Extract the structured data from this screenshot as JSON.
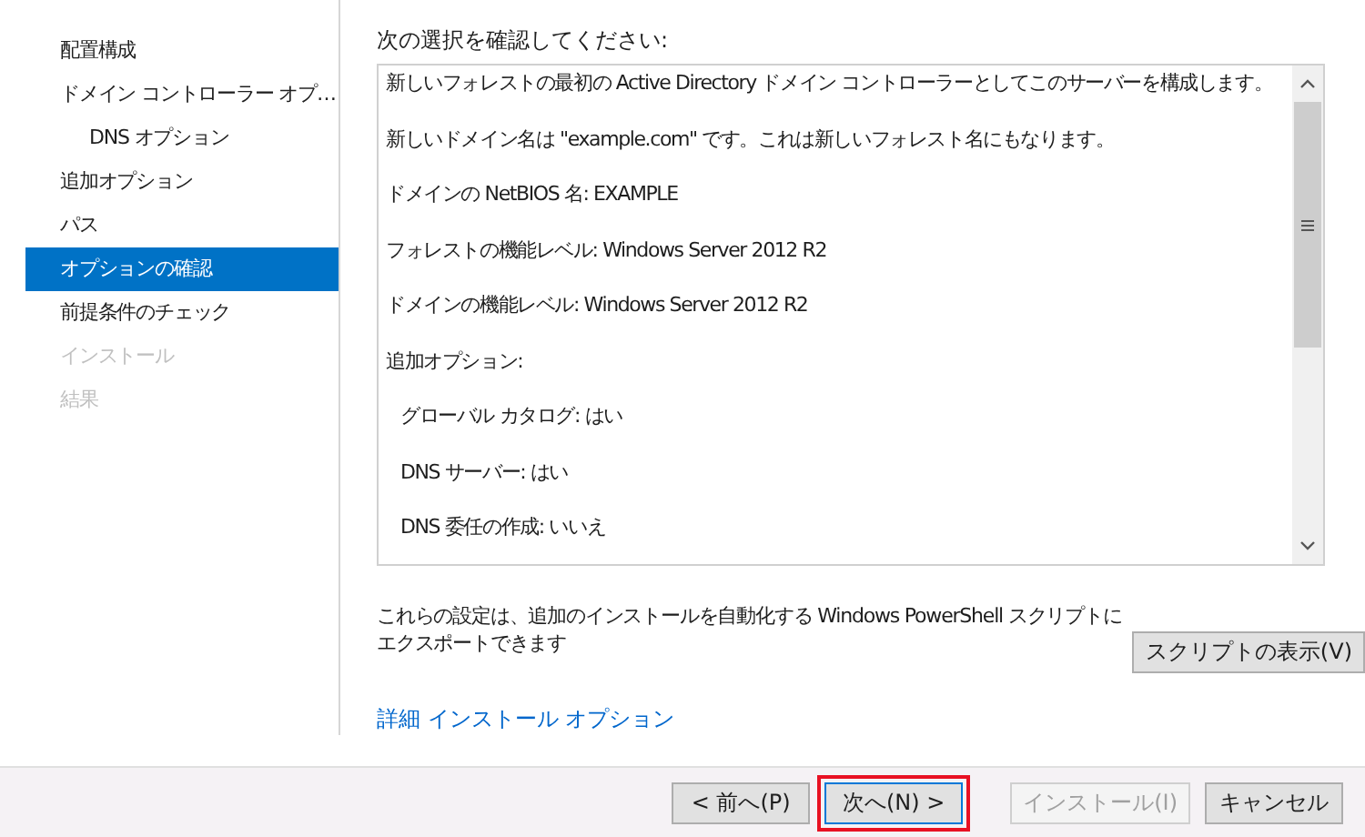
{
  "sidebar": {
    "items": [
      {
        "label": "配置構成",
        "selected": false,
        "disabled": false
      },
      {
        "label": "ドメイン コントローラー オプ…",
        "selected": false,
        "disabled": false,
        "children": [
          {
            "label": "DNS オプション",
            "selected": false,
            "disabled": false
          }
        ]
      },
      {
        "label": "追加オプション",
        "selected": false,
        "disabled": false
      },
      {
        "label": "パス",
        "selected": false,
        "disabled": false
      },
      {
        "label": "オプションの確認",
        "selected": true,
        "disabled": false
      },
      {
        "label": "前提条件のチェック",
        "selected": false,
        "disabled": false
      },
      {
        "label": "インストール",
        "selected": false,
        "disabled": true
      },
      {
        "label": "結果",
        "selected": false,
        "disabled": true
      }
    ]
  },
  "review": {
    "heading": "次の選択を確認してください:",
    "lines": [
      {
        "text": "新しいフォレストの最初の Active Directory ドメイン コントローラーとしてこのサーバーを構成します。",
        "indented": false
      },
      {
        "text": "新しいドメイン名は \"example.com\" です。これは新しいフォレスト名にもなります。",
        "indented": false
      },
      {
        "text": "ドメインの NetBIOS 名: EXAMPLE",
        "indented": false
      },
      {
        "text": "フォレストの機能レベル: Windows Server 2012 R2",
        "indented": false
      },
      {
        "text": "ドメインの機能レベル: Windows Server 2012 R2",
        "indented": false
      },
      {
        "text": "追加オプション:",
        "indented": false
      },
      {
        "text": "グローバル カタログ: はい",
        "indented": true
      },
      {
        "text": "DNS サーバー: はい",
        "indented": true
      },
      {
        "text": "DNS 委任の作成: いいえ",
        "indented": true
      }
    ]
  },
  "export_note": "これらの設定は、追加のインストールを自動化する Windows PowerShell スクリプトにエクスポートできます",
  "view_script_button": "スクリプトの表示(V)",
  "advanced_link": "詳細 インストール オプション",
  "buttons": [
    {
      "label": "< 前へ(P)",
      "disabled": false,
      "highlighted": false
    },
    {
      "label": "次へ(N) >",
      "disabled": false,
      "highlighted": true
    },
    {
      "label": "インストール(I)",
      "disabled": true,
      "highlighted": false
    },
    {
      "label": "キャンセル",
      "disabled": false,
      "highlighted": false
    }
  ]
}
